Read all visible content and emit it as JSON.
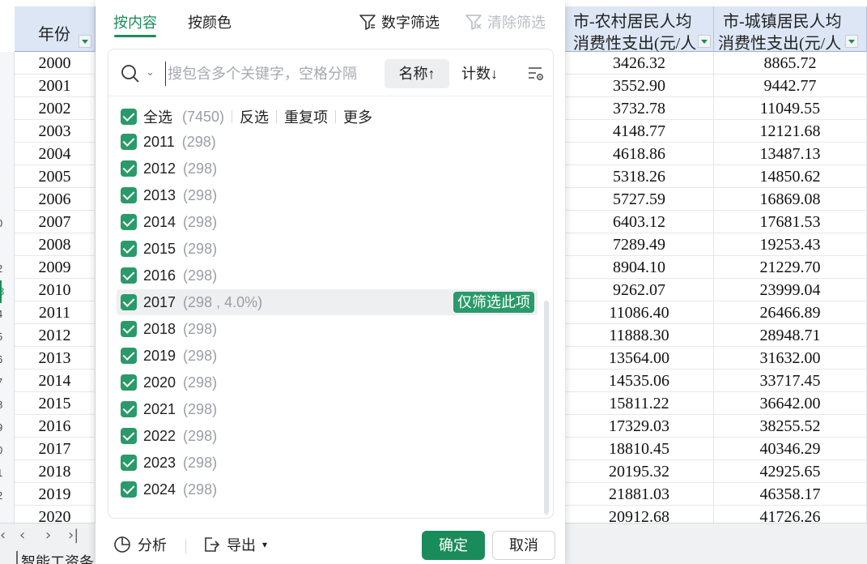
{
  "sheet": {
    "col_a_header": "年份",
    "col_rural_header": [
      "市-农村居民人均",
      "消费性支出(元/人"
    ],
    "col_urban_header": [
      "市-城镇居民人均",
      "消费性支出(元/人"
    ],
    "row_numbers": [
      "",
      "",
      "",
      "",
      "",
      "",
      "",
      "0",
      "",
      "2",
      "3",
      "4",
      "5",
      "6",
      "7",
      "8",
      "9",
      "0",
      "1",
      "2"
    ],
    "active_row_index": 10,
    "rows": [
      {
        "year": "2000",
        "rural": "3426.32",
        "urban": "8865.72"
      },
      {
        "year": "2001",
        "rural": "3552.90",
        "urban": "9442.77"
      },
      {
        "year": "2002",
        "rural": "3732.78",
        "urban": "11049.55"
      },
      {
        "year": "2003",
        "rural": "4148.77",
        "urban": "12121.68"
      },
      {
        "year": "2004",
        "rural": "4618.86",
        "urban": "13487.13"
      },
      {
        "year": "2005",
        "rural": "5318.26",
        "urban": "14850.62"
      },
      {
        "year": "2006",
        "rural": "5727.59",
        "urban": "16869.08"
      },
      {
        "year": "2007",
        "rural": "6403.12",
        "urban": "17681.53"
      },
      {
        "year": "2008",
        "rural": "7289.49",
        "urban": "19253.43"
      },
      {
        "year": "2009",
        "rural": "8904.10",
        "urban": "21229.70"
      },
      {
        "year": "2010",
        "rural": "9262.07",
        "urban": "23999.04"
      },
      {
        "year": "2011",
        "rural": "11086.40",
        "urban": "26466.89"
      },
      {
        "year": "2012",
        "rural": "11888.30",
        "urban": "28948.71"
      },
      {
        "year": "2013",
        "rural": "13564.00",
        "urban": "31632.00"
      },
      {
        "year": "2014",
        "rural": "14535.06",
        "urban": "33717.45"
      },
      {
        "year": "2015",
        "rural": "15811.22",
        "urban": "36642.00"
      },
      {
        "year": "2016",
        "rural": "17329.03",
        "urban": "38255.52"
      },
      {
        "year": "2017",
        "rural": "18810.45",
        "urban": "40346.29"
      },
      {
        "year": "2018",
        "rural": "20195.32",
        "urban": "42925.65"
      },
      {
        "year": "2019",
        "rural": "21881.03",
        "urban": "46358.17"
      },
      {
        "year": "2020",
        "rural": "20912.68",
        "urban": "41726.26"
      }
    ],
    "sheet_tab": "智能工资条"
  },
  "popup": {
    "tabs": [
      "按内容",
      "按颜色"
    ],
    "active_tab": 0,
    "number_filter": "数字筛选",
    "clear_filter": "清除筛选",
    "search_placeholder": "搜包含多个关键字，空格分隔",
    "sort_name": "名称↑",
    "sort_count": "计数↓",
    "select_all": "全选",
    "select_all_count": "(7450)",
    "invert": "反选",
    "duplicates": "重复项",
    "more": "更多",
    "items": [
      {
        "label": "2011",
        "count": "(298)"
      },
      {
        "label": "2012",
        "count": "(298)"
      },
      {
        "label": "2013",
        "count": "(298)"
      },
      {
        "label": "2014",
        "count": "(298)"
      },
      {
        "label": "2015",
        "count": "(298)"
      },
      {
        "label": "2016",
        "count": "(298)"
      },
      {
        "label": "2017",
        "count": "(298 , 4.0%)",
        "hover": true
      },
      {
        "label": "2018",
        "count": "(298)"
      },
      {
        "label": "2019",
        "count": "(298)"
      },
      {
        "label": "2020",
        "count": "(298)"
      },
      {
        "label": "2021",
        "count": "(298)"
      },
      {
        "label": "2022",
        "count": "(298)"
      },
      {
        "label": "2023",
        "count": "(298)"
      },
      {
        "label": "2024",
        "count": "(298)"
      }
    ],
    "only_this": "仅筛选此项",
    "analyze": "分析",
    "export": "导出",
    "ok": "确定",
    "cancel": "取消"
  },
  "colors": {
    "accent": "#1a8c5b",
    "checkbox": "#2a9a6a",
    "header_bg": "#dce6f5"
  }
}
